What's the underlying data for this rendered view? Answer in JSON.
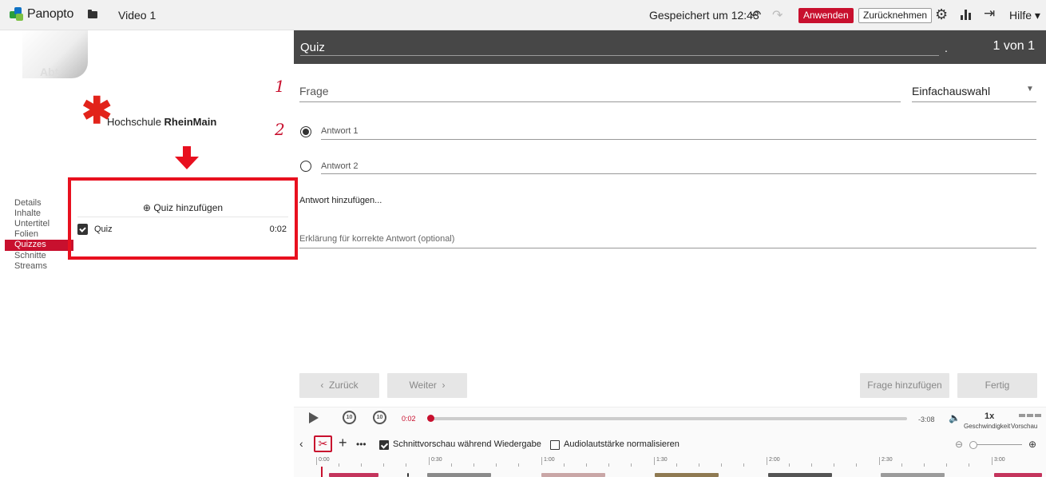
{
  "topbar": {
    "brand": "Panopto",
    "video_title": "Video 1",
    "saved_status": "Gespeichert um 12:43",
    "apply_label": "Anwenden",
    "revert_label": "Zurücknehmen",
    "help_label": "Hilfe",
    "accent_color": "#c8102e"
  },
  "sidebar": {
    "thumb_text": "Abt",
    "institution_prefix": "Hochschule ",
    "institution_bold": "RheinMain",
    "nav": [
      {
        "label": "Details",
        "active": false
      },
      {
        "label": "Inhalte",
        "active": false
      },
      {
        "label": "Untertitel",
        "active": false
      },
      {
        "label": "Folien",
        "active": false
      },
      {
        "label": "Quizzes",
        "active": true
      },
      {
        "label": "Schnitte",
        "active": false
      },
      {
        "label": "Streams",
        "active": false
      }
    ],
    "quiz_add_label": "Quiz hinzufügen",
    "quiz_item": {
      "label": "Quiz",
      "time": "0:02"
    }
  },
  "editor": {
    "title": "Quiz",
    "dot": ".",
    "counter": "1 von 1",
    "step1": "1",
    "step2": "2",
    "question_placeholder": "Frage",
    "question_type": "Einfachauswahl",
    "answers": [
      "Antwort 1",
      "Antwort 2"
    ],
    "add_answer": "Antwort hinzufügen...",
    "explanation_placeholder": "Erklärung für korrekte Antwort (optional)",
    "back_label": "Zurück",
    "next_label": "Weiter",
    "add_question_label": "Frage hinzufügen",
    "done_label": "Fertig"
  },
  "player": {
    "current_time": "0:02",
    "remaining": "-3:08",
    "speed_value": "1x",
    "speed_label": "Geschwindigkeit",
    "preview_label": "Vorschau",
    "skip_back": "10",
    "skip_fwd": "10",
    "preview_cut_label": "Schnittvorschau während Wiedergabe",
    "preview_cut_checked": true,
    "normalize_label": "Audiolautstärke normalisieren",
    "normalize_checked": false,
    "ticks": [
      "0:00",
      "0:30",
      "1:00",
      "1:30",
      "2:00",
      "2:30",
      "3:00"
    ]
  }
}
